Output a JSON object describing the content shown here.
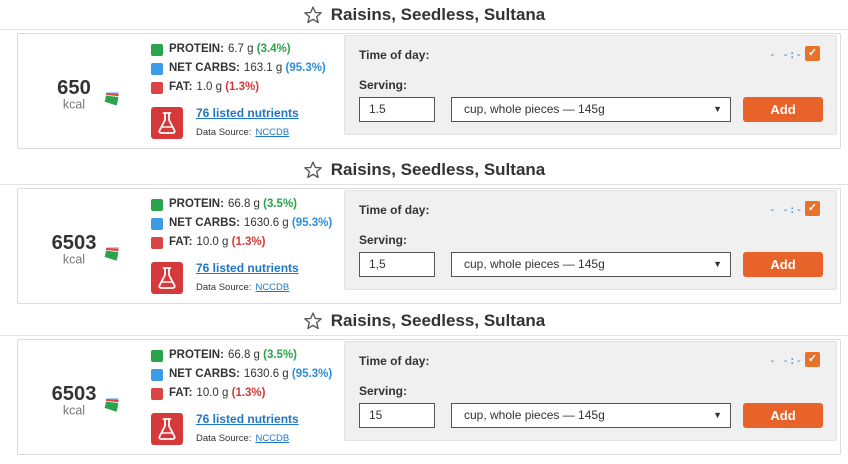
{
  "entries": [
    {
      "title": "Raisins, Seedless, Sultana",
      "calories": "650",
      "kcal_label": "kcal",
      "protein": {
        "label": "PROTEIN:",
        "amount": "6.7 g",
        "pct": "(3.4%)",
        "fraction": 0.034
      },
      "net_carbs": {
        "label": "NET CARBS:",
        "amount": "163.1 g",
        "pct": "(95.3%)",
        "fraction": 0.953
      },
      "fat": {
        "label": "FAT:",
        "amount": "1.0 g",
        "pct": "(1.3%)",
        "fraction": 0.013
      },
      "nutrients_link": "76 listed nutrients",
      "source_label": "Data Source:",
      "source_link": "NCCDB",
      "time_of_day_label": "Time of day:",
      "time_icon": "- -:- -",
      "serving_label": "Serving:",
      "quantity": "1.5",
      "unit": "cup, whole pieces — 145g",
      "add_label": "Add"
    },
    {
      "title": "Raisins, Seedless, Sultana",
      "calories": "6503",
      "kcal_label": "kcal",
      "protein": {
        "label": "PROTEIN:",
        "amount": "66.8 g",
        "pct": "(3.5%)",
        "fraction": 0.035
      },
      "net_carbs": {
        "label": "NET CARBS:",
        "amount": "1630.6 g",
        "pct": "(95.3%)",
        "fraction": 0.953
      },
      "fat": {
        "label": "FAT:",
        "amount": "10.0 g",
        "pct": "(1.3%)",
        "fraction": 0.013
      },
      "nutrients_link": "76 listed nutrients",
      "source_label": "Data Source:",
      "source_link": "NCCDB",
      "time_of_day_label": "Time of day:",
      "time_icon": "- -:- -",
      "serving_label": "Serving:",
      "quantity": "1,5",
      "unit": "cup, whole pieces — 145g",
      "add_label": "Add"
    },
    {
      "title": "Raisins, Seedless, Sultana",
      "calories": "6503",
      "kcal_label": "kcal",
      "protein": {
        "label": "PROTEIN:",
        "amount": "66.8 g",
        "pct": "(3.5%)",
        "fraction": 0.035
      },
      "net_carbs": {
        "label": "NET CARBS:",
        "amount": "1630.6 g",
        "pct": "(95.3%)",
        "fraction": 0.953
      },
      "fat": {
        "label": "FAT:",
        "amount": "10.0 g",
        "pct": "(1.3%)",
        "fraction": 0.013
      },
      "nutrients_link": "76 listed nutrients",
      "source_label": "Data Source:",
      "source_link": "NCCDB",
      "time_of_day_label": "Time of day:",
      "time_icon": "- -:- -",
      "serving_label": "Serving:",
      "quantity": "15",
      "unit": "cup, whole pieces — 145g",
      "add_label": "Add"
    }
  ],
  "colors": {
    "protein": "#2aa34a",
    "net_carbs": "#3a9be6",
    "fat": "#d94545",
    "accent": "#e8632a",
    "link": "#1f77c4"
  },
  "icons": {
    "favorite": "star-outline-icon",
    "nutrients": "flask-icon",
    "time": "clock-dash-icon",
    "checkbox": "checkmark-icon",
    "dropdown": "chevron-down-icon"
  }
}
